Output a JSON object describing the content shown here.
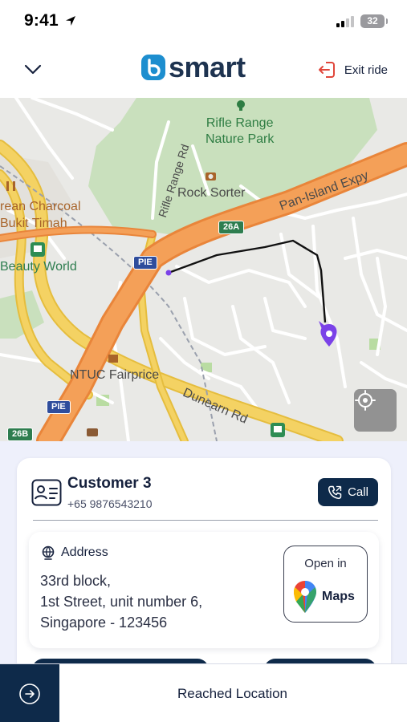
{
  "status_bar": {
    "time": "9:41",
    "battery": "32"
  },
  "header": {
    "logo_text": "smart",
    "exit_label": "Exit ride"
  },
  "map": {
    "labels": {
      "rifle_range_park_1": "Rifle Range",
      "rifle_range_park_2": "Nature Park",
      "rifle_range_rd": "Rifle Range Rd",
      "rock_sorter": "Rock Sorter",
      "pan_island": "Pan-Island Expy",
      "charcoal": "rean Charcoal",
      "bukit_timah": "Bukit Timah",
      "beauty_world": "Beauty World",
      "ntuc": "NTUC Fairprice",
      "dunearn": "Dunearn Rd"
    },
    "badges": {
      "b26a": "26A",
      "pie_top": "PIE",
      "pie_bottom": "PIE",
      "b26b": "26B"
    }
  },
  "customer": {
    "name": "Customer 3",
    "phone": "+65 9876543210",
    "call_label": "Call"
  },
  "address": {
    "title": "Address",
    "line1": "33rd block,",
    "line2": "1st Street, unit number 6,",
    "line3": "Singapore - 123456"
  },
  "maps_button": {
    "open_in": "Open in",
    "label": "Maps"
  },
  "action": {
    "label": "Reached Location"
  },
  "colors": {
    "navy": "#0e2a4a",
    "sheet_bg": "#eef0fb",
    "route_marker": "#7b42e8",
    "expressway": "#f49a4a"
  }
}
